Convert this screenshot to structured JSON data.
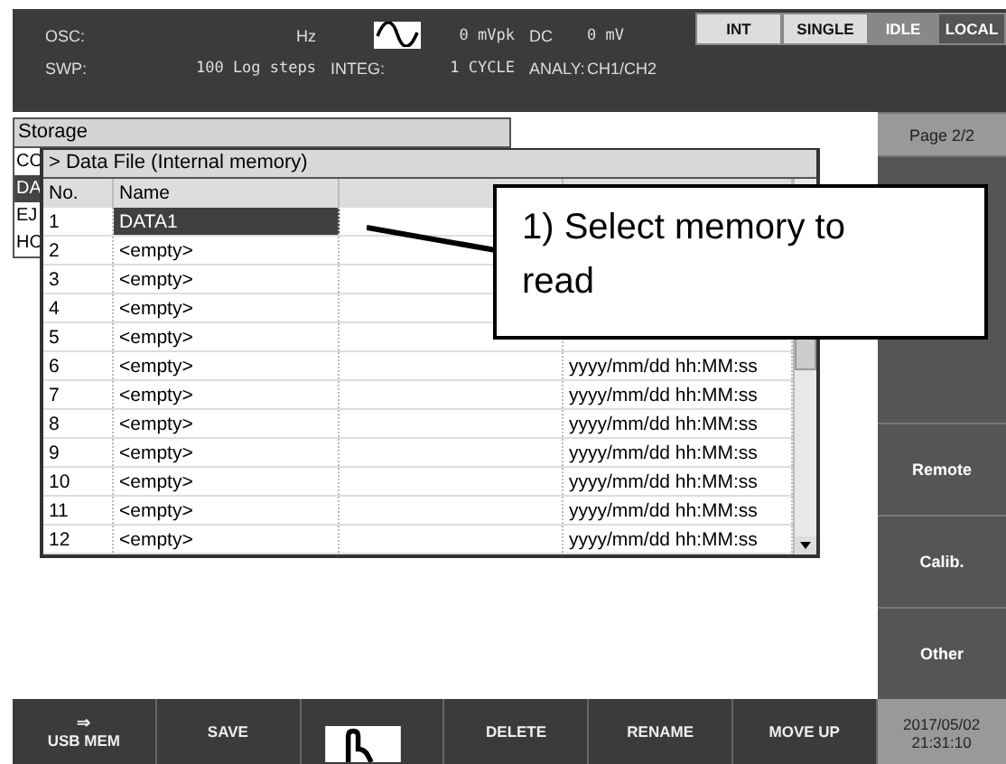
{
  "status": {
    "osc": {
      "label": "OSC:",
      "unit": "Hz",
      "amplitude": "0 mVpk",
      "dc_label": "DC",
      "dc_value": "0 mV"
    },
    "swp": {
      "label": "SWP:",
      "steps": "100 Log steps",
      "integ_label": "INTEG:",
      "integ_value": "1 CYCLE",
      "analy_label": "ANALY:",
      "analy_value": "CH1/CH2"
    },
    "mode_buttons": [
      {
        "label": "INT",
        "kind": "light"
      },
      {
        "label": "SINGLE",
        "kind": "light"
      },
      {
        "label": "IDLE",
        "kind": "medium"
      },
      {
        "label": "LOCAL",
        "kind": "dark"
      }
    ]
  },
  "panel_title": "Storage",
  "menu_items": [
    {
      "label": "CO",
      "selected": false
    },
    {
      "label": "DA",
      "selected": true
    },
    {
      "label": "EJ",
      "selected": false
    },
    {
      "label": "HO",
      "selected": false
    }
  ],
  "data_file": {
    "title": "> Data File (Internal memory)",
    "columns": [
      "No.",
      "Name"
    ],
    "rows": [
      {
        "no": "1",
        "name": "DATA1",
        "selected": true
      },
      {
        "no": "2",
        "name": "<empty>",
        "selected": false
      },
      {
        "no": "3",
        "name": "<empty>",
        "selected": false
      },
      {
        "no": "4",
        "name": "<empty>",
        "selected": false
      },
      {
        "no": "5",
        "name": "<empty>",
        "selected": false
      },
      {
        "no": "6",
        "name": "<empty>",
        "date": "yyyy/mm/dd hh:MM:ss",
        "selected": false
      },
      {
        "no": "7",
        "name": "<empty>",
        "date": "yyyy/mm/dd hh:MM:ss",
        "selected": false
      },
      {
        "no": "8",
        "name": "<empty>",
        "date": "yyyy/mm/dd hh:MM:ss",
        "selected": false
      },
      {
        "no": "9",
        "name": "<empty>",
        "date": "yyyy/mm/dd hh:MM:ss",
        "selected": false
      },
      {
        "no": "10",
        "name": "<empty>",
        "date": "yyyy/mm/dd hh:MM:ss",
        "selected": false
      },
      {
        "no": "11",
        "name": "<empty>",
        "date": "yyyy/mm/dd hh:MM:ss",
        "selected": false
      },
      {
        "no": "12",
        "name": "<empty>",
        "date": "yyyy/mm/dd hh:MM:ss",
        "selected": false
      }
    ]
  },
  "callout": "1) Select memory to read",
  "sidebar": {
    "page": "Page 2/2",
    "buttons": [
      "Remote",
      "Calib.",
      "Other"
    ]
  },
  "bottom_buttons": [
    {
      "icon": "⇒",
      "label": "USB MEM"
    },
    {
      "label": "SAVE"
    },
    {
      "kind": "hand_cursor"
    },
    {
      "label": "DELETE"
    },
    {
      "label": "RENAME"
    },
    {
      "label": "MOVE UP"
    }
  ],
  "datetime": {
    "date": "2017/05/02",
    "time": "21:31:10"
  }
}
